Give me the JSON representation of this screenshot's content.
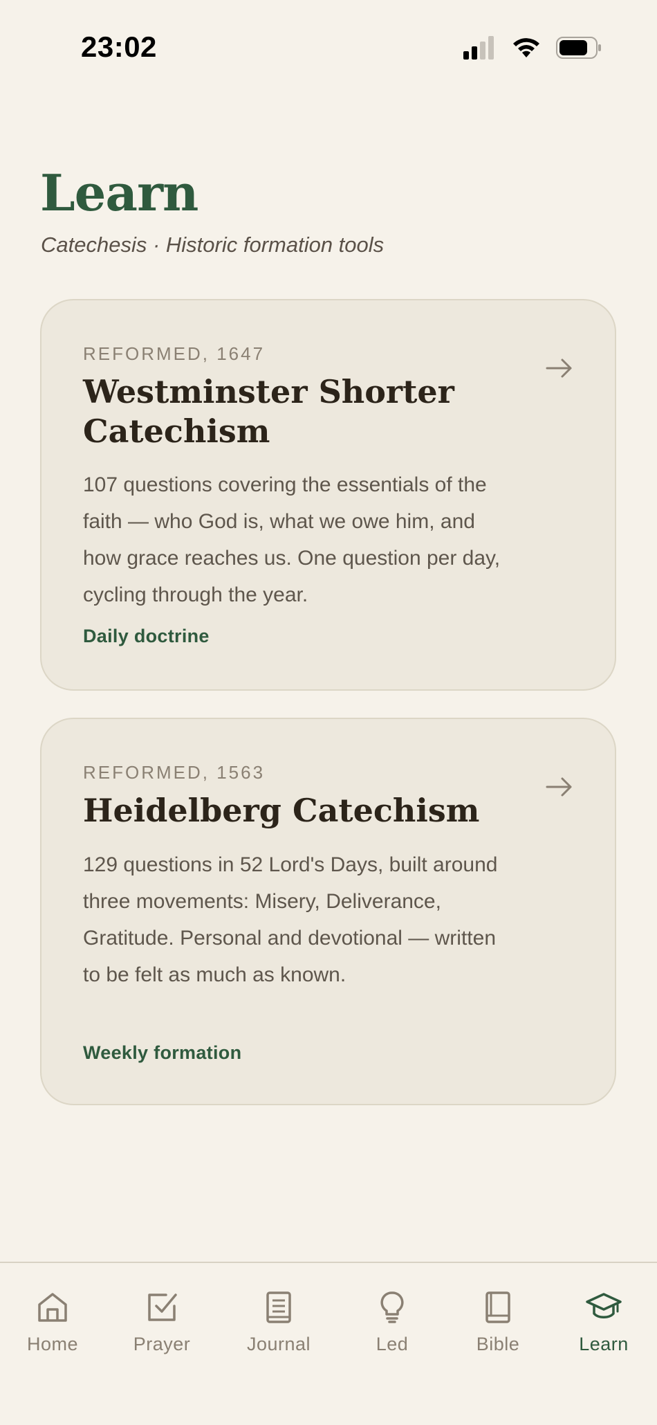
{
  "status_bar": {
    "time": "23:02"
  },
  "header": {
    "title": "Learn",
    "subtitle": "Catechesis · Historic formation tools"
  },
  "cards": [
    {
      "eyebrow": "REFORMED, 1647",
      "title": "Westminster Shorter Catechism",
      "description": "107 questions covering the essentials of the faith — who God is, what we owe him, and how grace reaches us. One question per day, cycling through the year.",
      "tag": "Daily doctrine",
      "icon": "arrow-right-icon"
    },
    {
      "eyebrow": "REFORMED, 1563",
      "title": "Heidelberg Catechism",
      "description": "129 questions in 52 Lord's Days, built around three movements: Misery, Deliverance, Gratitude. Personal and devotional — written to be felt as much as known.",
      "tag": "Weekly formation",
      "icon": "arrow-right-icon"
    }
  ],
  "tab_bar": {
    "tabs": [
      {
        "label": "Home",
        "icon": "home-icon"
      },
      {
        "label": "Prayer",
        "icon": "checkbox-icon"
      },
      {
        "label": "Journal",
        "icon": "journal-icon"
      },
      {
        "label": "Led",
        "icon": "lightbulb-icon"
      },
      {
        "label": "Bible",
        "icon": "book-icon"
      },
      {
        "label": "Learn",
        "icon": "graduation-cap-icon"
      }
    ],
    "active": "Learn"
  },
  "colors": {
    "background": "#f6f2ea",
    "card": "#ede8dd",
    "accent_green": "#2f5a3e",
    "muted": "#8a8073"
  }
}
